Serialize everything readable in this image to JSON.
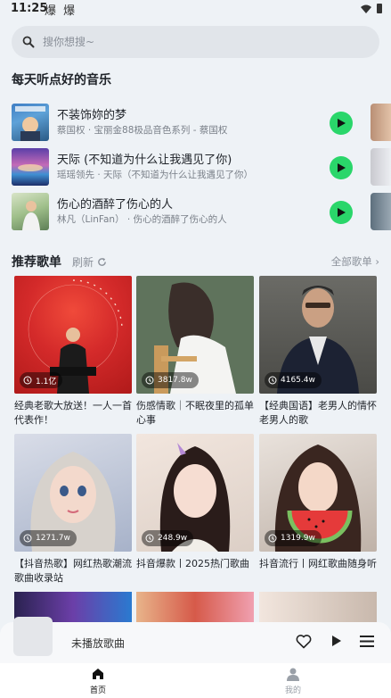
{
  "status": {
    "time": "11:25",
    "notif": "爆 爆"
  },
  "search": {
    "placeholder": "搜你想搜~"
  },
  "daily": {
    "title": "每天听点好的音乐",
    "songs": [
      {
        "title": "不装饰妳的梦",
        "subtitle": "蔡国权 · 宝丽金88极品音色系列 - 蔡国权"
      },
      {
        "title": "天际 (不知道为什么让我遇见了你)",
        "subtitle": "瑶瑶领先 · 天际（不知道为什么让我遇见了你）"
      },
      {
        "title": "伤心的酒醉了伤心的人",
        "subtitle": "林凡（LinFan） · 伤心的酒醉了伤心的人"
      }
    ]
  },
  "recommend": {
    "title": "推荐歌单",
    "refresh": "刷新",
    "all": "全部歌单 ›",
    "playlists": [
      {
        "count": "1.1亿",
        "title": "经典老歌大放送！一人一首代表作！"
      },
      {
        "count": "3817.8w",
        "title": "伤感情歌｜不眠夜里的孤单心事"
      },
      {
        "count": "4165.4w",
        "title": "【经典国语】老男人的情怀 老男人的歌"
      },
      {
        "count": "1271.7w",
        "title": "【抖音热歌】网红热歌潮流歌曲收录站"
      },
      {
        "count": "248.9w",
        "title": "抖音爆款丨2025热门歌曲"
      },
      {
        "count": "1319.9w",
        "title": "抖音流行丨网红歌曲随身听"
      }
    ]
  },
  "player": {
    "text": "未播放歌曲"
  },
  "nav": {
    "home": "首页",
    "mine": "我的"
  },
  "colors": {
    "accent": "#2ad66a",
    "background": "#eef2f6"
  }
}
